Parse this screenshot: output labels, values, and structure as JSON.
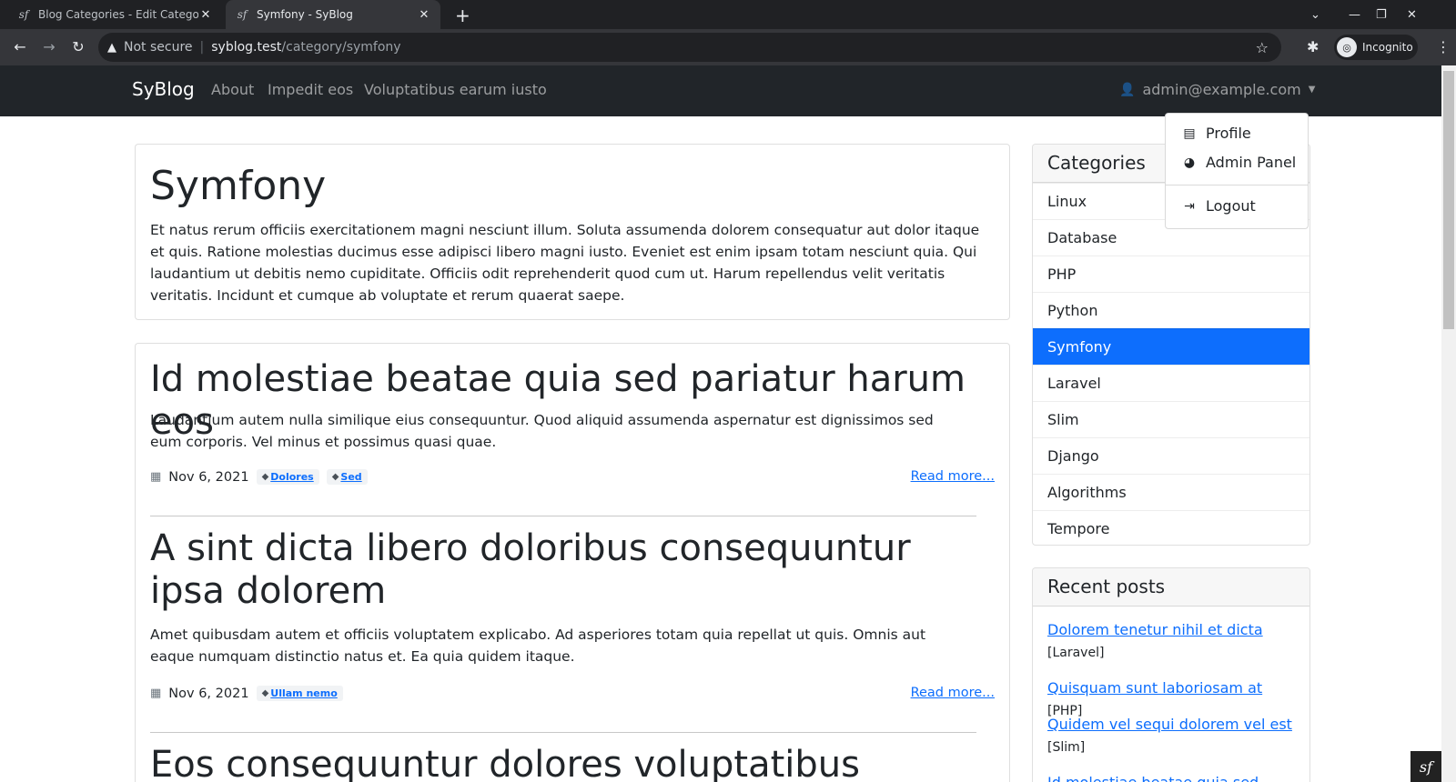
{
  "browser": {
    "tabs": [
      {
        "title": "Blog Categories - Edit Category",
        "active": false
      },
      {
        "title": "Symfony - SyBlog",
        "active": true
      }
    ],
    "security_label": "Not secure",
    "url_host": "syblog.test",
    "url_path": "/category/symfony",
    "profile_label": "Incognito"
  },
  "navbar": {
    "brand": "SyBlog",
    "links": [
      "About",
      "Impedit eos",
      "Voluptatibus earum iusto"
    ],
    "user": "admin@example.com"
  },
  "dropdown": {
    "items": [
      "Profile",
      "Admin Panel",
      "Logout"
    ]
  },
  "category": {
    "title": "Symfony",
    "description": "Et natus rerum officiis exercitationem magni nesciunt illum. Soluta assumenda dolorem consequatur aut dolor itaque et quis. Ratione molestias ducimus esse adipisci libero magni iusto. Eveniet est enim ipsam totam nesciunt quia. Qui laudantium ut debitis nemo cupiditate. Officiis odit reprehenderit quod cum ut. Harum repellendus velit veritatis veritatis. Incidunt et cumque ab voluptate et rerum quaerat saepe."
  },
  "posts": [
    {
      "title": "Id molestiae beatae quia sed pariatur harum eos",
      "excerpt": "Laudantium autem nulla similique eius consequuntur. Quod aliquid assumenda aspernatur est dignissimos sed eum corporis. Vel minus et possimus quasi quae.",
      "date": "Nov 6, 2021",
      "tags": [
        "Dolores",
        "Sed"
      ],
      "read_more": "Read more..."
    },
    {
      "title": "A sint dicta libero doloribus consequuntur ipsa dolorem",
      "excerpt": "Amet quibusdam autem et officiis voluptatem explicabo. Ad asperiores totam quia repellat ut quis. Omnis aut eaque numquam distinctio natus et. Ea quia quidem itaque.",
      "date": "Nov 6, 2021",
      "tags": [
        "Ullam nemo"
      ],
      "read_more": "Read more..."
    },
    {
      "title": "Eos consequuntur dolores voluptatibus"
    }
  ],
  "sidebar": {
    "categories_title": "Categories",
    "categories": [
      "Linux",
      "Database",
      "PHP",
      "Python",
      "Symfony",
      "Laravel",
      "Slim",
      "Django",
      "Algorithms",
      "Tempore"
    ],
    "active_category": "Symfony",
    "recent_title": "Recent posts",
    "recent": [
      {
        "title": "Dolorem tenetur nihil et dicta",
        "category": "[Laravel]"
      },
      {
        "title": "Quisquam sunt laboriosam at",
        "category": "[PHP]"
      },
      {
        "title": "Quidem vel sequi dolorem vel est",
        "category": "[Slim]"
      },
      {
        "title": "Id molestiae beatae quia sed",
        "category": ""
      }
    ]
  },
  "colors": {
    "accent": "#0d6efd",
    "navbar": "#212529",
    "chrome": "#202124"
  }
}
